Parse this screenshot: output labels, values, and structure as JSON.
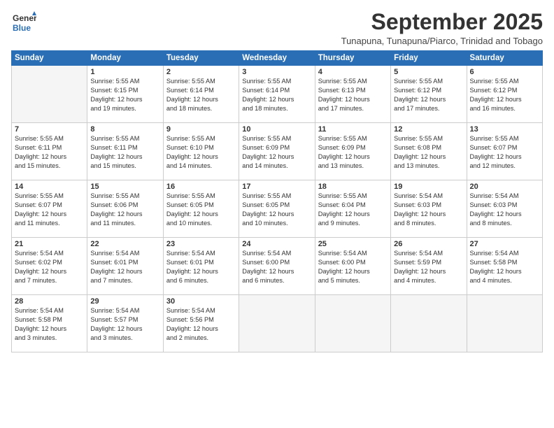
{
  "logo": {
    "line1": "General",
    "line2": "Blue"
  },
  "title": "September 2025",
  "subtitle": "Tunapuna, Tunapuna/Piarco, Trinidad and Tobago",
  "days_of_week": [
    "Sunday",
    "Monday",
    "Tuesday",
    "Wednesday",
    "Thursday",
    "Friday",
    "Saturday"
  ],
  "weeks": [
    [
      {
        "day": "",
        "content": ""
      },
      {
        "day": "1",
        "content": "Sunrise: 5:55 AM\nSunset: 6:15 PM\nDaylight: 12 hours\nand 19 minutes."
      },
      {
        "day": "2",
        "content": "Sunrise: 5:55 AM\nSunset: 6:14 PM\nDaylight: 12 hours\nand 18 minutes."
      },
      {
        "day": "3",
        "content": "Sunrise: 5:55 AM\nSunset: 6:14 PM\nDaylight: 12 hours\nand 18 minutes."
      },
      {
        "day": "4",
        "content": "Sunrise: 5:55 AM\nSunset: 6:13 PM\nDaylight: 12 hours\nand 17 minutes."
      },
      {
        "day": "5",
        "content": "Sunrise: 5:55 AM\nSunset: 6:12 PM\nDaylight: 12 hours\nand 17 minutes."
      },
      {
        "day": "6",
        "content": "Sunrise: 5:55 AM\nSunset: 6:12 PM\nDaylight: 12 hours\nand 16 minutes."
      }
    ],
    [
      {
        "day": "7",
        "content": "Sunrise: 5:55 AM\nSunset: 6:11 PM\nDaylight: 12 hours\nand 15 minutes."
      },
      {
        "day": "8",
        "content": "Sunrise: 5:55 AM\nSunset: 6:11 PM\nDaylight: 12 hours\nand 15 minutes."
      },
      {
        "day": "9",
        "content": "Sunrise: 5:55 AM\nSunset: 6:10 PM\nDaylight: 12 hours\nand 14 minutes."
      },
      {
        "day": "10",
        "content": "Sunrise: 5:55 AM\nSunset: 6:09 PM\nDaylight: 12 hours\nand 14 minutes."
      },
      {
        "day": "11",
        "content": "Sunrise: 5:55 AM\nSunset: 6:09 PM\nDaylight: 12 hours\nand 13 minutes."
      },
      {
        "day": "12",
        "content": "Sunrise: 5:55 AM\nSunset: 6:08 PM\nDaylight: 12 hours\nand 13 minutes."
      },
      {
        "day": "13",
        "content": "Sunrise: 5:55 AM\nSunset: 6:07 PM\nDaylight: 12 hours\nand 12 minutes."
      }
    ],
    [
      {
        "day": "14",
        "content": "Sunrise: 5:55 AM\nSunset: 6:07 PM\nDaylight: 12 hours\nand 11 minutes."
      },
      {
        "day": "15",
        "content": "Sunrise: 5:55 AM\nSunset: 6:06 PM\nDaylight: 12 hours\nand 11 minutes."
      },
      {
        "day": "16",
        "content": "Sunrise: 5:55 AM\nSunset: 6:05 PM\nDaylight: 12 hours\nand 10 minutes."
      },
      {
        "day": "17",
        "content": "Sunrise: 5:55 AM\nSunset: 6:05 PM\nDaylight: 12 hours\nand 10 minutes."
      },
      {
        "day": "18",
        "content": "Sunrise: 5:55 AM\nSunset: 6:04 PM\nDaylight: 12 hours\nand 9 minutes."
      },
      {
        "day": "19",
        "content": "Sunrise: 5:54 AM\nSunset: 6:03 PM\nDaylight: 12 hours\nand 8 minutes."
      },
      {
        "day": "20",
        "content": "Sunrise: 5:54 AM\nSunset: 6:03 PM\nDaylight: 12 hours\nand 8 minutes."
      }
    ],
    [
      {
        "day": "21",
        "content": "Sunrise: 5:54 AM\nSunset: 6:02 PM\nDaylight: 12 hours\nand 7 minutes."
      },
      {
        "day": "22",
        "content": "Sunrise: 5:54 AM\nSunset: 6:01 PM\nDaylight: 12 hours\nand 7 minutes."
      },
      {
        "day": "23",
        "content": "Sunrise: 5:54 AM\nSunset: 6:01 PM\nDaylight: 12 hours\nand 6 minutes."
      },
      {
        "day": "24",
        "content": "Sunrise: 5:54 AM\nSunset: 6:00 PM\nDaylight: 12 hours\nand 6 minutes."
      },
      {
        "day": "25",
        "content": "Sunrise: 5:54 AM\nSunset: 6:00 PM\nDaylight: 12 hours\nand 5 minutes."
      },
      {
        "day": "26",
        "content": "Sunrise: 5:54 AM\nSunset: 5:59 PM\nDaylight: 12 hours\nand 4 minutes."
      },
      {
        "day": "27",
        "content": "Sunrise: 5:54 AM\nSunset: 5:58 PM\nDaylight: 12 hours\nand 4 minutes."
      }
    ],
    [
      {
        "day": "28",
        "content": "Sunrise: 5:54 AM\nSunset: 5:58 PM\nDaylight: 12 hours\nand 3 minutes."
      },
      {
        "day": "29",
        "content": "Sunrise: 5:54 AM\nSunset: 5:57 PM\nDaylight: 12 hours\nand 3 minutes."
      },
      {
        "day": "30",
        "content": "Sunrise: 5:54 AM\nSunset: 5:56 PM\nDaylight: 12 hours\nand 2 minutes."
      },
      {
        "day": "",
        "content": ""
      },
      {
        "day": "",
        "content": ""
      },
      {
        "day": "",
        "content": ""
      },
      {
        "day": "",
        "content": ""
      }
    ]
  ]
}
